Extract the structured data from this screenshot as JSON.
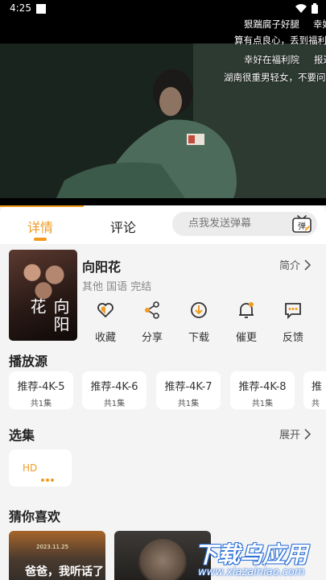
{
  "status": {
    "time": "4:25"
  },
  "video": {
    "danmaku": [
      "狠踹腐子好腿",
      "幸好",
      "算有点良心，丢到福利",
      "幸好在福利院",
      "报过",
      "湖南很重男轻女，不要问"
    ]
  },
  "tabs": [
    {
      "label": "详情"
    },
    {
      "label": "评论"
    }
  ],
  "danmu": {
    "placeholder": "点我发送弹幕",
    "button": "弹"
  },
  "movie": {
    "title": "向阳花",
    "meta": "其他 国语 完结",
    "intro_label": "简介",
    "poster_text": "向阳花"
  },
  "actions": [
    {
      "label": "收藏",
      "icon": "heart-icon"
    },
    {
      "label": "分享",
      "icon": "share-icon"
    },
    {
      "label": "下载",
      "icon": "download-icon"
    },
    {
      "label": "催更",
      "icon": "bell-icon"
    },
    {
      "label": "反馈",
      "icon": "feedback-icon"
    }
  ],
  "sources": {
    "title": "播放源",
    "items": [
      {
        "name": "推荐-4K-5",
        "count": "共1集"
      },
      {
        "name": "推荐-4K-6",
        "count": "共1集"
      },
      {
        "name": "推荐-4K-7",
        "count": "共1集"
      },
      {
        "name": "推荐-4K-8",
        "count": "共1集"
      },
      {
        "name": "推",
        "count": "共"
      }
    ]
  },
  "episodes": {
    "title": "选集",
    "expand_label": "展开",
    "items": [
      {
        "label": "HD"
      }
    ]
  },
  "recommend": {
    "title": "猜你喜欢",
    "items": [
      {
        "title": "爸爸，我听话了",
        "subtitle": "2023.11.25"
      },
      {
        "title": ""
      }
    ]
  },
  "watermark": {
    "main": "下载乌应用",
    "sub": "www.xiazainiao.com"
  },
  "colors": {
    "accent": "#f29a1e",
    "background": "#f4f4f4"
  }
}
